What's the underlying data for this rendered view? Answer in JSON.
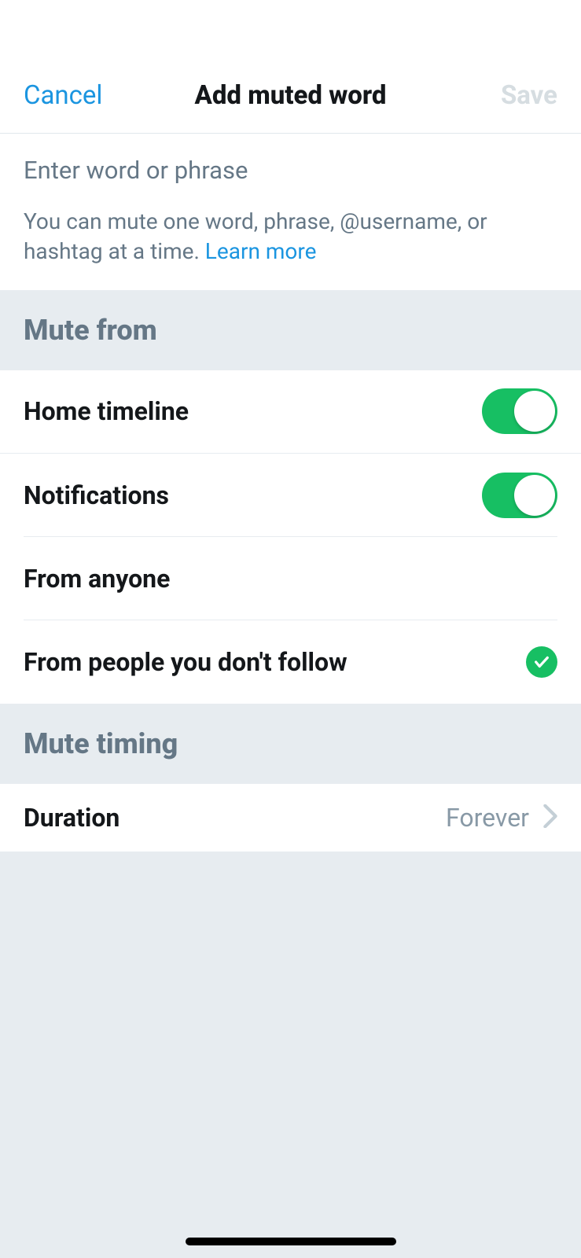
{
  "nav": {
    "cancel": "Cancel",
    "title": "Add muted word",
    "save": "Save"
  },
  "input": {
    "placeholder": "Enter word or phrase",
    "helper": "You can mute one word, phrase, @username, or hashtag at a time. ",
    "learn_more": "Learn more"
  },
  "sections": {
    "mute_from": "Mute from",
    "mute_timing": "Mute timing"
  },
  "rows": {
    "home_timeline": "Home timeline",
    "notifications": "Notifications",
    "from_anyone": "From anyone",
    "from_not_follow": "From people you don't follow",
    "duration": "Duration",
    "duration_value": "Forever"
  },
  "toggles": {
    "home_timeline": true,
    "notifications": true
  }
}
